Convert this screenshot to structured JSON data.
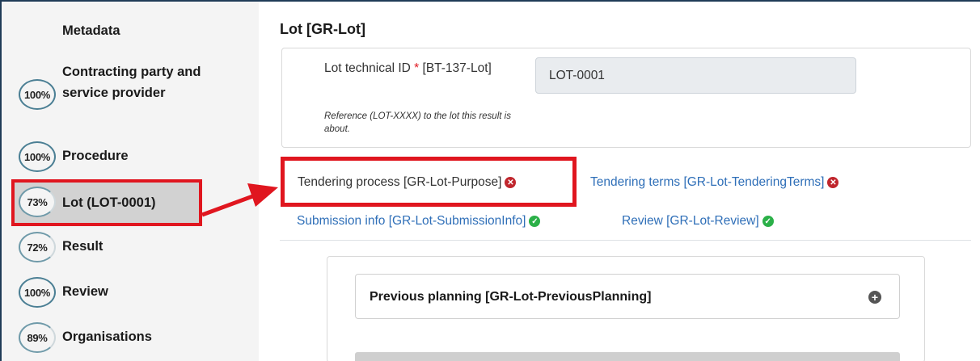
{
  "sidebar": {
    "metadata_label": "Metadata",
    "items": [
      {
        "percent": "100%",
        "label": "Contracting party and service provider"
      },
      {
        "percent": "100%",
        "label": "Procedure"
      },
      {
        "percent": "73%",
        "label": "Lot (LOT-0001)"
      },
      {
        "percent": "72%",
        "label": "Result"
      },
      {
        "percent": "100%",
        "label": "Review"
      },
      {
        "percent": "89%",
        "label": "Organisations"
      }
    ]
  },
  "main": {
    "title": "Lot [GR-Lot]",
    "field": {
      "label": "Lot technical ID",
      "required_mark": "*",
      "code": "[BT-137-Lot]",
      "help": "Reference (LOT-XXXX) to the lot this result is about.",
      "value": "LOT-0001"
    },
    "tabs": [
      {
        "label": "Tendering process  [GR-Lot-Purpose]",
        "status": "error"
      },
      {
        "label": "Tendering terms  [GR-Lot-TenderingTerms]",
        "status": "error"
      },
      {
        "label": "Submission info  [GR-Lot-SubmissionInfo]",
        "status": "ok"
      },
      {
        "label": "Review  [GR-Lot-Review]",
        "status": "ok"
      }
    ],
    "accordion": {
      "title": "Previous planning  [GR-Lot-PreviousPlanning]"
    }
  },
  "colors": {
    "highlight": "#e0161f",
    "link": "#2f6fb8",
    "error": "#c0262d",
    "ok": "#2bb048",
    "ring": "#4b7f94"
  }
}
